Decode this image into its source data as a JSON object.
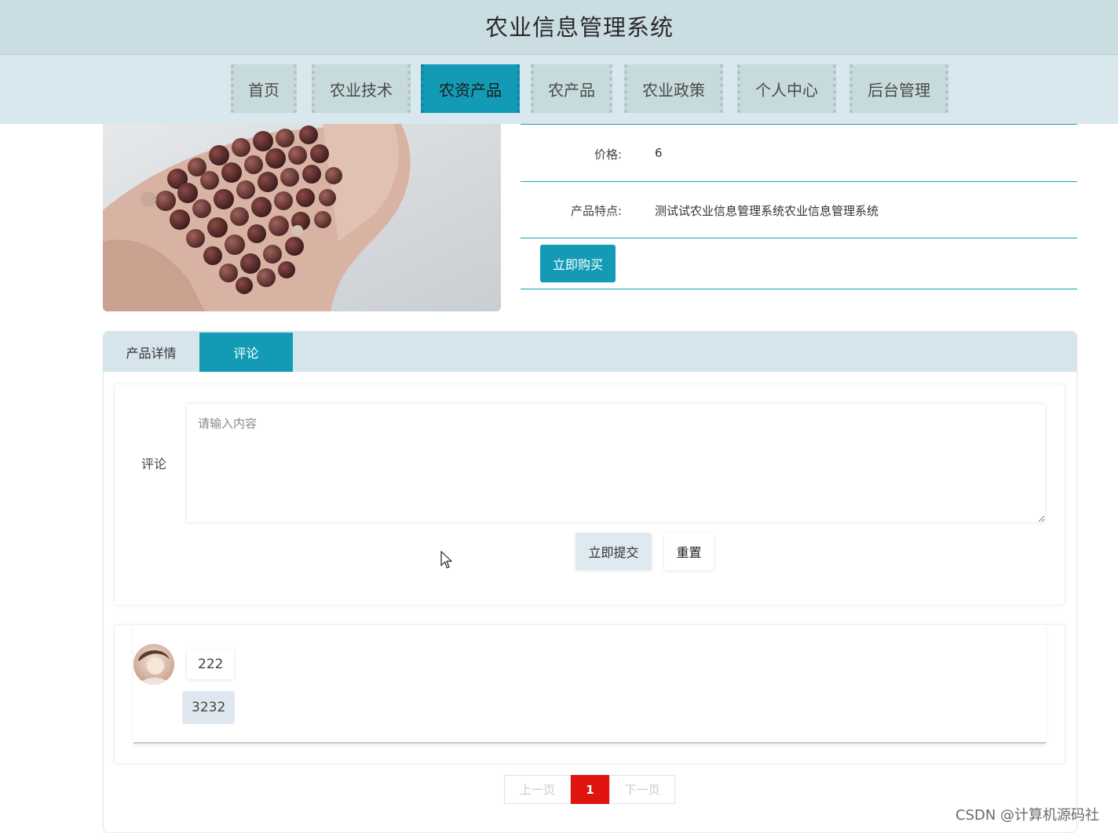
{
  "header": {
    "title": "农业信息管理系统"
  },
  "nav": {
    "items": [
      {
        "label": "首页"
      },
      {
        "label": "农业技术"
      },
      {
        "label": "农资产品"
      },
      {
        "label": "农产品"
      },
      {
        "label": "农业政策"
      },
      {
        "label": "个人中心"
      },
      {
        "label": "后台管理"
      }
    ],
    "active_index": 2,
    "accent_color": "#139bb6"
  },
  "product": {
    "image_icon": "beans-in-hand-photo",
    "price_label": "价格:",
    "price_value": "6",
    "feature_label": "产品特点:",
    "feature_value": "测试试农业信息管理系统农业信息管理系统",
    "buy_label": "立即购买"
  },
  "tabs": {
    "items": [
      {
        "label": "产品详情"
      },
      {
        "label": "评论"
      }
    ],
    "active_index": 1
  },
  "comment_form": {
    "label": "评论",
    "placeholder": "请输入内容",
    "value": "",
    "submit_label": "立即提交",
    "reset_label": "重置"
  },
  "comments": [
    {
      "avatar_icon": "user-avatar",
      "content": "222",
      "reply": "3232"
    }
  ],
  "pagination": {
    "prev_label": "上一页",
    "current_page": "1",
    "next_label": "下一页",
    "active_color": "#e0140e"
  },
  "watermark": "CSDN @计算机源码社"
}
